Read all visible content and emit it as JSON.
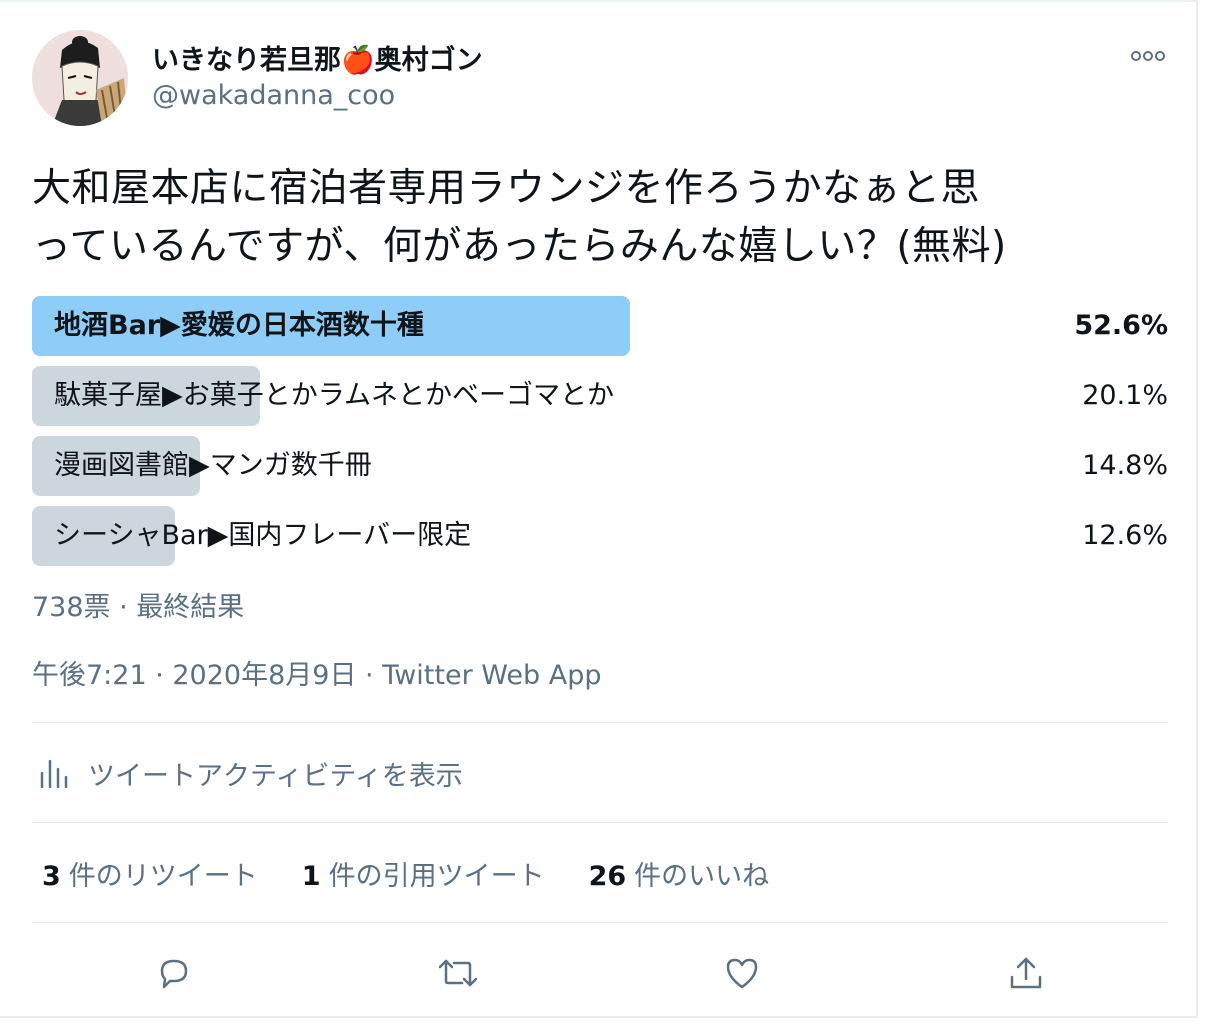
{
  "user": {
    "display_name": "いきなり若旦那🍎奥村ゴン",
    "handle": "@wakadanna_coo",
    "avatar_icon": "ukiyoe-portrait-avatar"
  },
  "tweet": {
    "text": "大和屋本店に宿泊者専用ラウンジを作ろうかなぁと思\nっているんですが、何があったらみんな嬉しい？(無料)"
  },
  "poll": {
    "options": [
      {
        "label": "地酒Bar▶愛媛の日本酒数十種",
        "percent_text": "52.6%",
        "percent": 52.6,
        "winner": true
      },
      {
        "label": "駄菓子屋▶お菓子とかラムネとかベーゴマとか",
        "percent_text": "20.1%",
        "percent": 20.1,
        "winner": false
      },
      {
        "label": "漫画図書館▶マンガ数千冊",
        "percent_text": "14.8%",
        "percent": 14.8,
        "winner": false
      },
      {
        "label": "シーシャBar▶国内フレーバー限定",
        "percent_text": "12.6%",
        "percent": 12.6,
        "winner": false
      }
    ],
    "meta": "738票 · 最終結果"
  },
  "timestamp": "午後7:21 · 2020年8月9日 · Twitter Web App",
  "activity_label": "ツイートアクティビティを表示",
  "stats": {
    "retweets_count": "3",
    "retweets_label": "件のリツイート",
    "quotes_count": "1",
    "quotes_label": "件の引用ツイート",
    "likes_count": "26",
    "likes_label": "件のいいね"
  },
  "colors": {
    "winner_bar": "#8ecdf8",
    "other_bar": "#ccd6dd",
    "secondary_text": "#5b7083",
    "icon": "#5b7083"
  },
  "icons": [
    "more-icon",
    "analytics-icon",
    "reply-icon",
    "retweet-icon",
    "like-icon",
    "share-icon"
  ]
}
